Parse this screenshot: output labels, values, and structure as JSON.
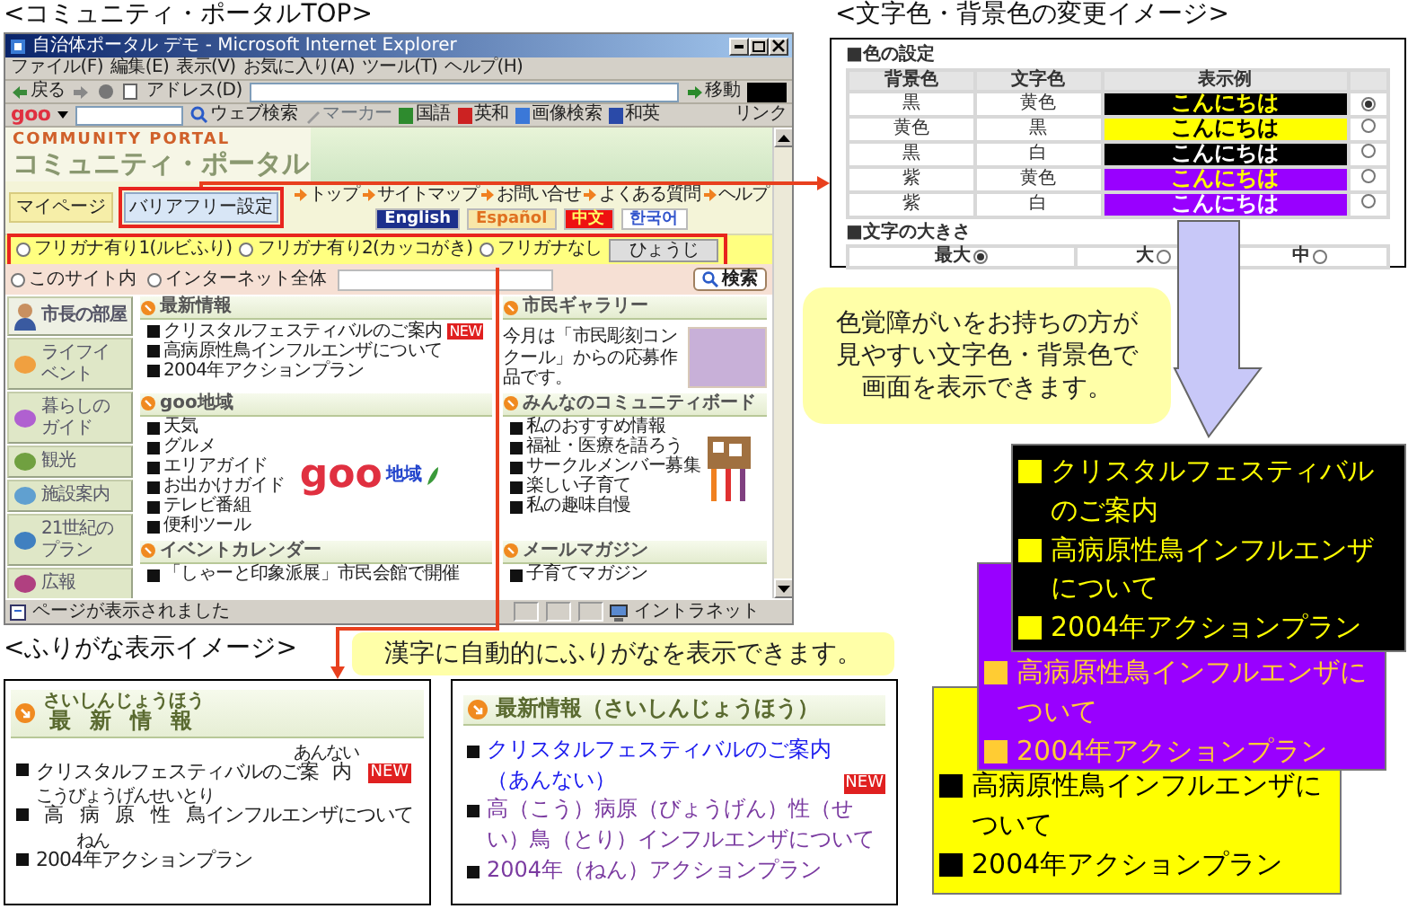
{
  "portal_caption": "<コミュニティ・ポータルTOP>",
  "color_caption": "<文字色・背景色の変更イメージ>",
  "furigana_caption": "<ふりがな表示イメージ>",
  "browser": {
    "title": "自治体ポータル デモ - Microsoft Internet Explorer",
    "menu": [
      "ファイル(F)",
      "編集(E)",
      "表示(V)",
      "お気に入り(A)",
      "ツール(T)",
      "ヘルプ(H)"
    ],
    "back": "戻る",
    "address_label": "アドレス(D)",
    "go": "移動",
    "goo_logo": "goo",
    "web_search": "ウェブ検索",
    "marker": "マーカー",
    "dictionaries": [
      {
        "label": "国語",
        "color": "#2e8b2e"
      },
      {
        "label": "英和",
        "color": "#cc2222"
      },
      {
        "label": "画像検索",
        "color": "#3b78d8"
      },
      {
        "label": "和英",
        "color": "#2a4aa8"
      }
    ],
    "links": "リンク",
    "status": "ページが表示されました",
    "zone": "イントラネット"
  },
  "site": {
    "logo_en": "COMMUNITY PORTAL",
    "logo_ja": "コミュニティ・ポータル",
    "mypage": "マイページ",
    "barrier_free": "バリアフリー設定",
    "top_links": [
      "トップ",
      "サイトマップ",
      "お問い合せ",
      "よくある質問",
      "ヘルプ"
    ],
    "languages": [
      {
        "label": "English",
        "color": "#1c2f8c"
      },
      {
        "label": "Español",
        "color": "#f8e6a8"
      },
      {
        "label": "中文",
        "color": "#ee1111"
      },
      {
        "label": "한국어",
        "color": "#ffffff"
      }
    ],
    "furigana_options": [
      {
        "label": "フリガナ有り1(ルビふり)",
        "selected": false
      },
      {
        "label": "フリガナ有り2(カッコがき)",
        "selected": false
      },
      {
        "label": "フリガナなし",
        "selected": false
      }
    ],
    "furigana_button": "ひょうじ",
    "search_scopes": [
      {
        "label": "このサイト内",
        "selected": false
      },
      {
        "label": "インターネット全体",
        "selected": false
      }
    ],
    "search_button": "検索",
    "sidebar": [
      {
        "label": "市長の部屋",
        "kind": "mayor"
      },
      {
        "label": "ライフイベント",
        "kind": "menu"
      },
      {
        "label": "暮らしのガイド",
        "kind": "menu"
      },
      {
        "label": "観光",
        "kind": "menu"
      },
      {
        "label": "施設案内",
        "kind": "menu"
      },
      {
        "label": "21世紀のプラン",
        "kind": "menu"
      },
      {
        "label": "広報",
        "kind": "menu"
      }
    ],
    "sections": [
      {
        "title": "最新情報",
        "kind": "list",
        "items": [
          {
            "text": "クリスタルフェスティバルのご案内",
            "badge": "NEW"
          },
          {
            "text": "高病原性鳥インフルエンザについて"
          },
          {
            "text": "2004年アクションプラン"
          }
        ]
      },
      {
        "title": "市民ギャラリー",
        "kind": "gallery",
        "text": "今月は「市民彫刻コンクール」からの応募作品です。"
      },
      {
        "title": "goo地域",
        "kind": "list",
        "logo": {
          "mark": "goo",
          "label": "地域"
        },
        "items": [
          {
            "text": "天気"
          },
          {
            "text": "グルメ"
          },
          {
            "text": "エリアガイド"
          },
          {
            "text": "お出かけガイド"
          },
          {
            "text": "テレビ番組"
          },
          {
            "text": "便利ツール"
          }
        ]
      },
      {
        "title": "みんなのコミュニティボード",
        "kind": "board",
        "items": [
          {
            "text": "私のおすすめ情報"
          },
          {
            "text": "福祉・医療を語ろう"
          },
          {
            "text": "サークルメンバー募集"
          },
          {
            "text": "楽しい子育て"
          },
          {
            "text": "私の趣味自慢"
          }
        ]
      },
      {
        "title": "イベントカレンダー",
        "kind": "list",
        "items": [
          {
            "text": "「しゃーと印象派展」市民会館で開催"
          }
        ]
      },
      {
        "title": "メールマガジン",
        "kind": "list",
        "items": [
          {
            "text": "子育てマガジン"
          }
        ]
      }
    ]
  },
  "color_settings": {
    "title": "■色の設定",
    "columns": [
      "背景色",
      "文字色",
      "表示例"
    ],
    "rows": [
      {
        "background_name": "黒",
        "text_name": "黄色",
        "sample": {
          "text": "こんにちは",
          "color": "#ffff00"
        },
        "background": {
          "color": "#000000"
        },
        "selected": true
      },
      {
        "background_name": "黄色",
        "text_name": "黒",
        "sample": {
          "text": "こんにちは",
          "color": "#000000"
        },
        "background": {
          "color": "#ffff00"
        },
        "selected": false
      },
      {
        "background_name": "黒",
        "text_name": "白",
        "sample": {
          "text": "こんにちは",
          "color": "#ffffff"
        },
        "background": {
          "color": "#000000"
        },
        "selected": false
      },
      {
        "background_name": "紫",
        "text_name": "黄色",
        "sample": {
          "text": "こんにちは",
          "color": "#ffff00"
        },
        "background": {
          "color": "#9900ff"
        },
        "selected": false
      },
      {
        "background_name": "紫",
        "text_name": "白",
        "sample": {
          "text": "こんにちは",
          "color": "#ffffff"
        },
        "background": {
          "color": "#9900ff"
        },
        "selected": false
      }
    ],
    "size_title": "■文字の大きさ",
    "sizes": [
      {
        "label": "最大",
        "selected": true
      },
      {
        "label": "大",
        "selected": false
      },
      {
        "label": "中",
        "selected": false
      }
    ]
  },
  "color_note": "色覚障がいをお持ちの方が見やすい文字色・背景色で画面を表示できます。",
  "color_previews": [
    {
      "background": {
        "color": "#000000"
      },
      "color": "#ffff00",
      "items": [
        "クリスタルフェスティバルのご案内",
        "高病原性鳥インフルエンザについて",
        "2004年アクションプラン"
      ]
    },
    {
      "background": {
        "color": "#9900ff"
      },
      "color": "#ffcc33",
      "items": [
        "高病原性鳥インフルエンザについて",
        "2004年アクションプラン"
      ]
    },
    {
      "background": {
        "color": "#ffff00"
      },
      "color": "#000000",
      "items": [
        "高病原性鳥インフルエンザについて",
        "2004年アクションプラン"
      ]
    }
  ],
  "furigana_note": "漢字に自動的にふりがなを表示できます。",
  "ruby_preview": {
    "title": {
      "text": "最新情報",
      "ruby": "さいしんじょうほう"
    },
    "items": [
      {
        "segments": [
          {
            "text": "クリスタルフェスティバルのご"
          },
          {
            "text": "案内",
            "ruby": "あんない"
          }
        ],
        "badge": "NEW"
      },
      {
        "segments": [
          {
            "text": "高病原性鳥",
            "ruby": "こうびょうげんせいとり"
          },
          {
            "text": "インフルエンザについて"
          }
        ]
      },
      {
        "segments": [
          {
            "text": "2004"
          },
          {
            "text": "年",
            "ruby": "ねん"
          },
          {
            "text": "アクションプラン"
          }
        ]
      }
    ]
  },
  "paren_preview": {
    "title": "最新情報（さいしんじょうほう）",
    "items": [
      {
        "text": "クリスタルフェスティバルのご案内（あんない）",
        "badge": "NEW",
        "visited": false
      },
      {
        "text": "高（こう）病原（びょうげん）性（せい）鳥（とり）インフルエンザについて",
        "visited": true
      },
      {
        "text": "2004年（ねん）アクションプラン",
        "visited": true
      }
    ]
  }
}
